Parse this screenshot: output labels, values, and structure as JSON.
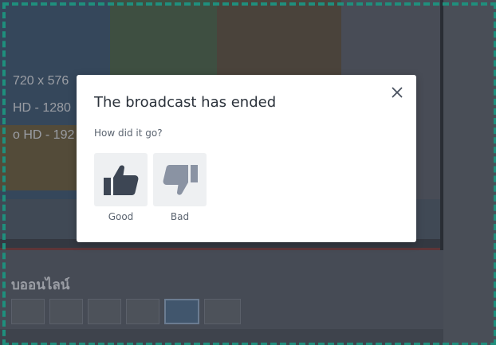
{
  "background": {
    "resolutions": [
      "720 x 576",
      "HD - 1280",
      "o HD - 192"
    ],
    "section_title": "บออนไลน์"
  },
  "modal": {
    "title": "The broadcast has ended",
    "question": "How did it go?",
    "options": [
      {
        "label": "Good",
        "icon": "thumbs-up-icon"
      },
      {
        "label": "Bad",
        "icon": "thumbs-down-icon"
      }
    ],
    "close_icon": "close-icon"
  },
  "colors": {
    "accent_frame": "#1f8f7d",
    "good_icon": "#3d4654",
    "bad_icon": "#8a93a3"
  }
}
